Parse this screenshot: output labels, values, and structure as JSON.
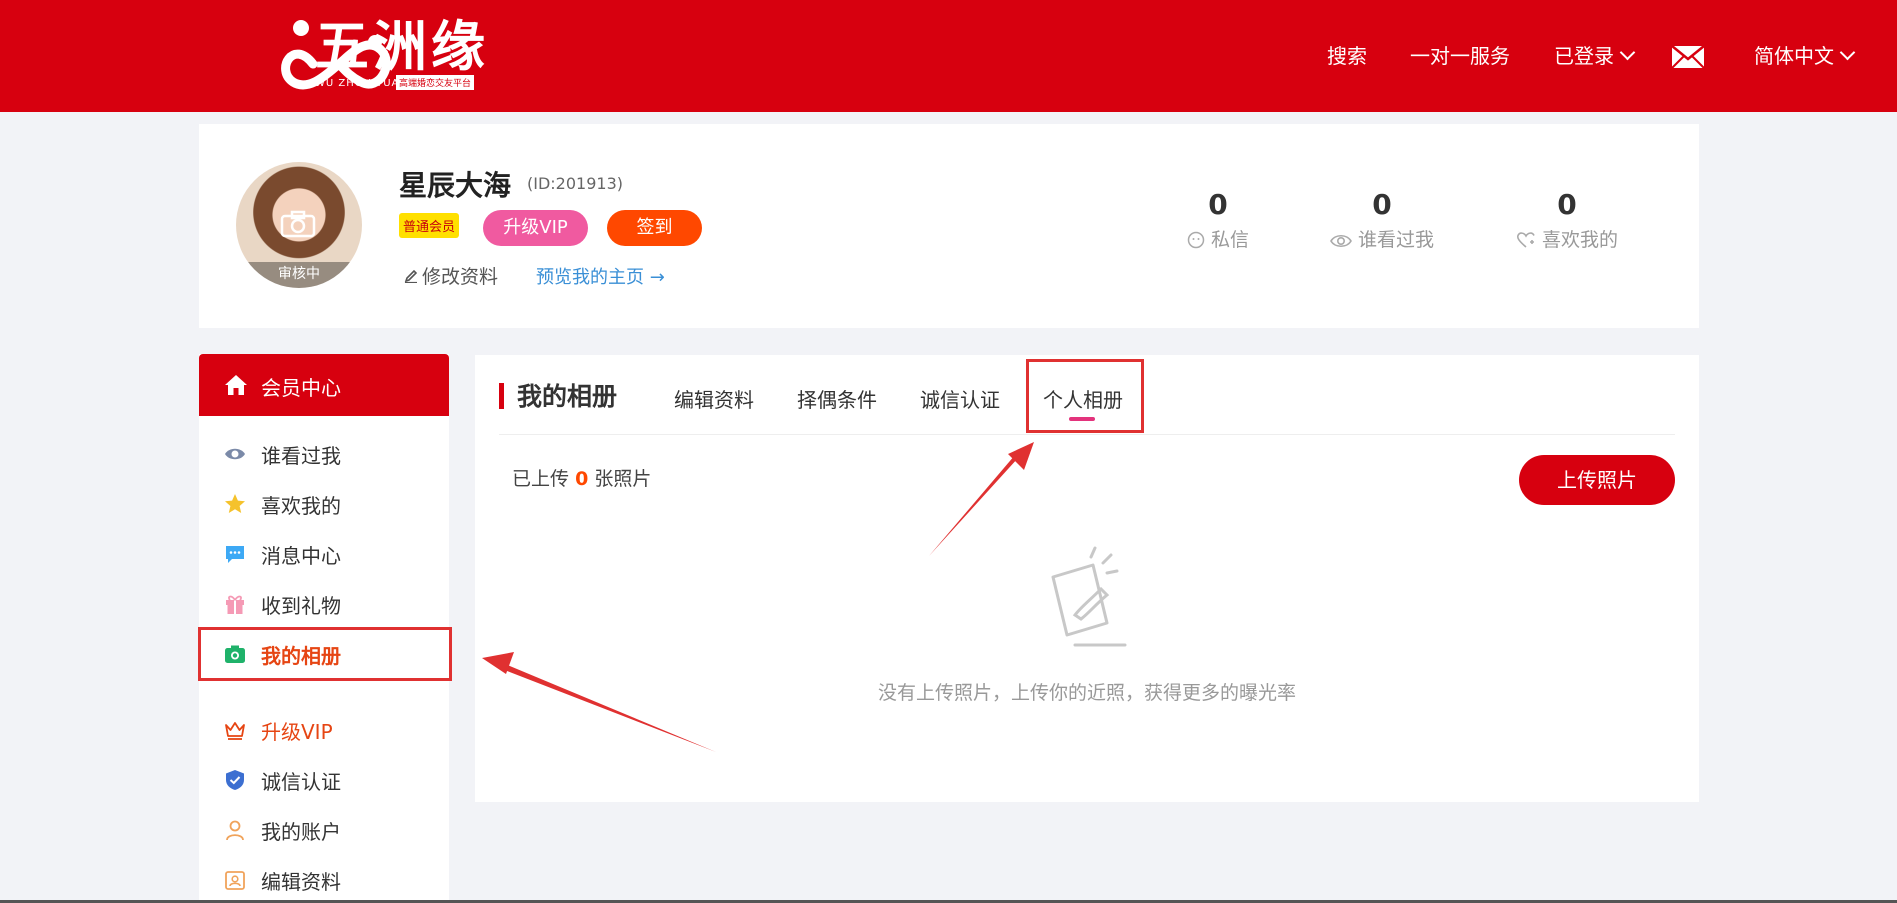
{
  "header": {
    "logo_text": "五洲缘",
    "logo_sub": "WU ZHOU YUAN",
    "logo_tag": "高端婚恋交友平台",
    "nav": [
      {
        "label": "搜索"
      },
      {
        "label": "一对一服务"
      },
      {
        "label": "已登录"
      },
      {
        "label": "简体中文"
      }
    ]
  },
  "profile": {
    "avatar_status": "审核中",
    "name": "星辰大海",
    "id": "(ID:201913)",
    "member_badge": "普通会员",
    "vip_button": "升级VIP",
    "checkin_button": "签到",
    "edit_link": "修改资料",
    "preview_link": "预览我的主页 →",
    "stats": [
      {
        "value": "0",
        "label": "私信",
        "icon": "chat-icon"
      },
      {
        "value": "0",
        "label": "谁看过我",
        "icon": "eye-icon"
      },
      {
        "value": "0",
        "label": "喜欢我的",
        "icon": "heart-icon"
      }
    ]
  },
  "sidebar": {
    "title": "会员中心",
    "items": [
      {
        "label": "谁看过我",
        "icon": "eye-icon"
      },
      {
        "label": "喜欢我的",
        "icon": "star-icon"
      },
      {
        "label": "消息中心",
        "icon": "message-icon"
      },
      {
        "label": "收到礼物",
        "icon": "gift-icon"
      },
      {
        "label": "我的相册",
        "icon": "camera-icon"
      },
      {
        "label": "升级VIP",
        "icon": "crown-icon"
      },
      {
        "label": "诚信认证",
        "icon": "shield-icon"
      },
      {
        "label": "我的账户",
        "icon": "user-icon"
      },
      {
        "label": "编辑资料",
        "icon": "profile-card-icon"
      }
    ]
  },
  "main": {
    "title": "我的相册",
    "tabs": [
      {
        "label": "编辑资料"
      },
      {
        "label": "择偶条件"
      },
      {
        "label": "诚信认证"
      },
      {
        "label": "个人相册"
      }
    ],
    "upload_prefix": "已上传",
    "upload_count": "0",
    "upload_suffix": "张照片",
    "upload_button": "上传照片",
    "empty_text": "没有上传照片，上传你的近照，获得更多的曝光率"
  },
  "colors": {
    "brand_red": "#d7000f",
    "accent_orange": "#ff4800",
    "vip_pink": "#f05aa0",
    "annotation_red": "#e03131"
  }
}
